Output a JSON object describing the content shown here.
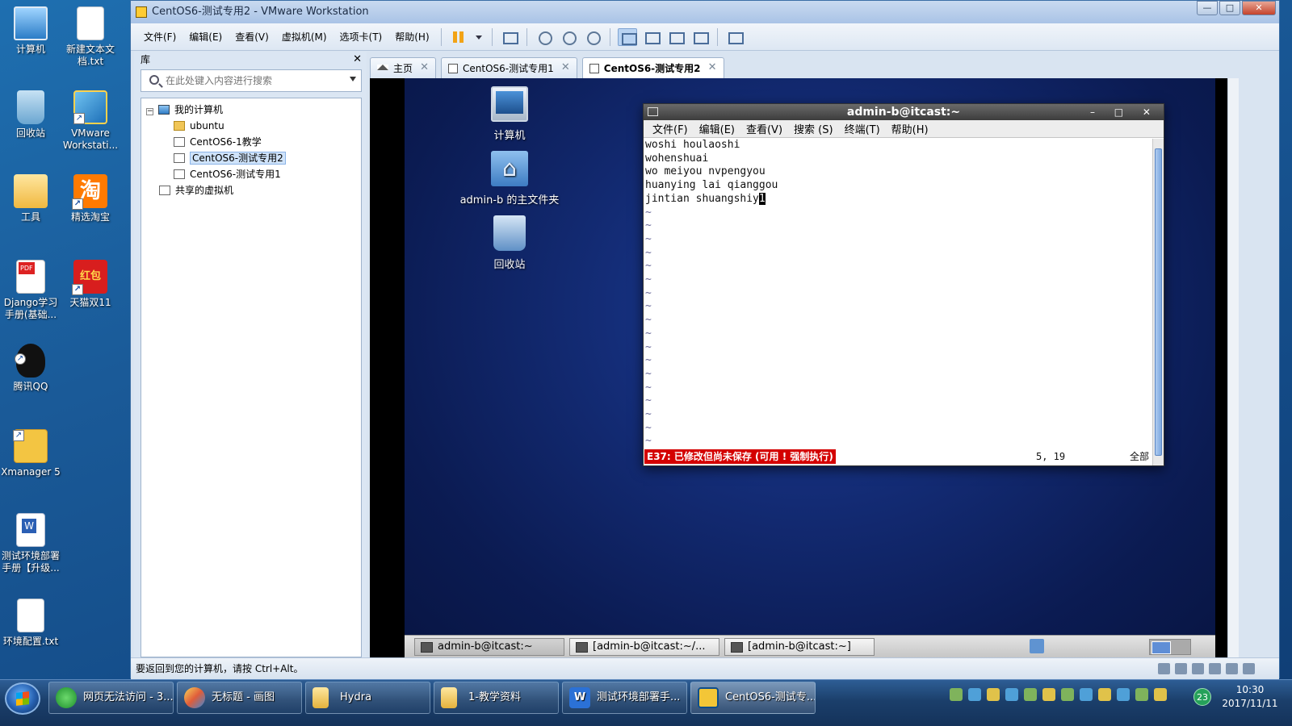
{
  "desktop": {
    "icons": [
      {
        "label": "计算机"
      },
      {
        "label": "新建文本文档.txt"
      },
      {
        "label": "回收站"
      },
      {
        "label": "VMware Workstati..."
      },
      {
        "label": "工具"
      },
      {
        "label": "精选淘宝"
      },
      {
        "label": "Django学习手册(基础..."
      },
      {
        "label": "天猫双11"
      },
      {
        "label": "腾讯QQ"
      },
      {
        "label": "Xmanager 5"
      },
      {
        "label": "测试环境部署手册【升级..."
      },
      {
        "label": "环境配置.txt"
      }
    ],
    "taobao_glyph": "淘",
    "hongbao_glyph": "红包"
  },
  "vmware": {
    "title": "CentOS6-测试专用2 - VMware Workstation",
    "window_buttons": {
      "minimize": "—",
      "maximize": "□",
      "close": "✕"
    },
    "menu": [
      "文件(F)",
      "编辑(E)",
      "查看(V)",
      "虚拟机(M)",
      "选项卡(T)",
      "帮助(H)"
    ],
    "library": {
      "title": "库",
      "close": "✕",
      "search_placeholder": "在此处键入内容进行搜索",
      "tree": [
        {
          "label": "我的计算机",
          "expander": "−"
        },
        {
          "label": "ubuntu"
        },
        {
          "label": "CentOS6-1教学"
        },
        {
          "label": "CentOS6-测试专用2"
        },
        {
          "label": "CentOS6-测试专用1"
        },
        {
          "label": "共享的虚拟机"
        }
      ]
    },
    "tabs": [
      {
        "label": "主页",
        "close": "✕"
      },
      {
        "label": "CentOS6-测试专用1",
        "close": "✕"
      },
      {
        "label": "CentOS6-测试专用2",
        "close": "✕"
      }
    ],
    "status_text": "要返回到您的计算机，请按 Ctrl+Alt。"
  },
  "guest": {
    "desktop_icons": [
      {
        "label": "计算机"
      },
      {
        "label": "admin-b 的主文件夹"
      },
      {
        "label": "回收站"
      }
    ],
    "terminal": {
      "title": "admin-b@itcast:~",
      "title_buttons": "– □ ✕",
      "menu": [
        "文件(F)",
        "编辑(E)",
        "查看(V)",
        "搜索 (S)",
        "终端(T)",
        "帮助(H)"
      ],
      "lines": [
        "woshi houlaoshi",
        "wohenshuai",
        "wo meiyou nvpengyou",
        "huanying lai qianggou"
      ],
      "last_line": "jintian shuangshiy",
      "cursor_char": "1",
      "tilde": "~",
      "error": "E37: 已修改但尚未保存 (可用 ! 强制执行)",
      "position": "5, 19",
      "scope": "全部"
    },
    "panel_tasks": [
      {
        "label": "admin-b@itcast:~"
      },
      {
        "label": "[admin-b@itcast:~/..."
      },
      {
        "label": "[admin-b@itcast:~]"
      }
    ]
  },
  "taskbar": {
    "items": [
      {
        "label": "网页无法访问 - 3..."
      },
      {
        "label": "无标题 - 画图"
      },
      {
        "label": "Hydra"
      },
      {
        "label": "1-教学资料"
      },
      {
        "label": "测试环境部署手..."
      },
      {
        "label": "CentOS6-测试专..."
      }
    ],
    "notification_count": "23",
    "time": "10:30",
    "date": "2017/11/11"
  }
}
